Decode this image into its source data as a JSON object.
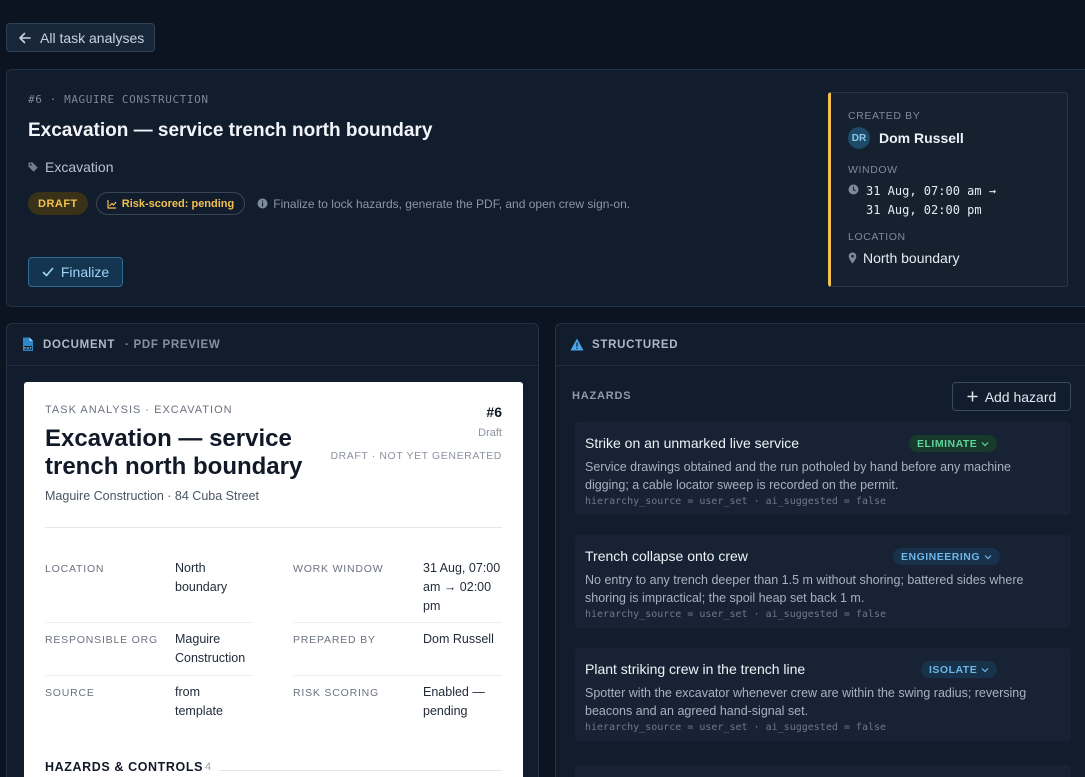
{
  "nav": {
    "back_label": "All task analyses"
  },
  "header": {
    "eyebrow": "#6  ·  MAGUIRE CONSTRUCTION",
    "title": "Excavation — service trench north boundary",
    "tag": "Excavation",
    "status_badge": "DRAFT",
    "risk_badge": "Risk-scored: pending",
    "hint": "Finalize to lock hazards, generate the PDF, and open crew sign-on.",
    "finalize_label": "Finalize",
    "meta": {
      "created_by_label": "CREATED BY",
      "creator_initials": "DR",
      "creator_name": "Dom Russell",
      "window_label": "WINDOW",
      "window_value": "31 Aug, 07:00 am → 31 Aug, 02:00 pm",
      "location_label": "LOCATION",
      "location_value": "North boundary"
    },
    "accent_color": "#f2c14e"
  },
  "document": {
    "panel_title": "DOCUMENT",
    "panel_sub": "· PDF PREVIEW",
    "paper": {
      "eyebrow": "TASK ANALYSIS · EXCAVATION",
      "title": "Excavation — service trench north boundary",
      "subtitle": "Maguire Construction · 84 Cuba Street",
      "number": "#6",
      "status": "Draft",
      "generation": "DRAFT · NOT YET GENERATED",
      "fields": [
        {
          "label": "LOCATION",
          "value": "North boundary"
        },
        {
          "label": "WORK WINDOW",
          "value": "31 Aug, 07:00 am → 02:00 pm"
        },
        {
          "label": "RESPONSIBLE ORG",
          "value": "Maguire Construction"
        },
        {
          "label": "PREPARED BY",
          "value": "Dom Russell"
        },
        {
          "label": "SOURCE",
          "value": "from template"
        },
        {
          "label": "RISK SCORING",
          "value": "Enabled — pending"
        }
      ],
      "section_title": "HAZARDS & CONTROLS",
      "section_count": "4"
    }
  },
  "structured": {
    "panel_title": "STRUCTURED",
    "hazards_label": "HAZARDS",
    "add_hazard_label": "Add hazard",
    "hazards": [
      {
        "title": "Strike on an unmarked live service",
        "control": "ELIMINATE",
        "description": "Service drawings obtained and the run potholed by hand before any machine digging; a cable locator sweep is recorded on the permit.",
        "meta": "hierarchy_source = user_set · ai_suggested = false"
      },
      {
        "title": "Trench collapse onto crew",
        "control": "ENGINEERING",
        "description": "No entry to any trench deeper than 1.5 m without shoring; battered sides where shoring is impractical; the spoil heap set back 1 m.",
        "meta": "hierarchy_source = user_set · ai_suggested = false"
      },
      {
        "title": "Plant striking crew in the trench line",
        "control": "ISOLATE",
        "description": "Spotter with the excavator whenever crew are within the swing radius; reversing beacons and an agreed hand-signal set.",
        "meta": "hierarchy_source = user_set · ai_suggested = false"
      }
    ]
  }
}
